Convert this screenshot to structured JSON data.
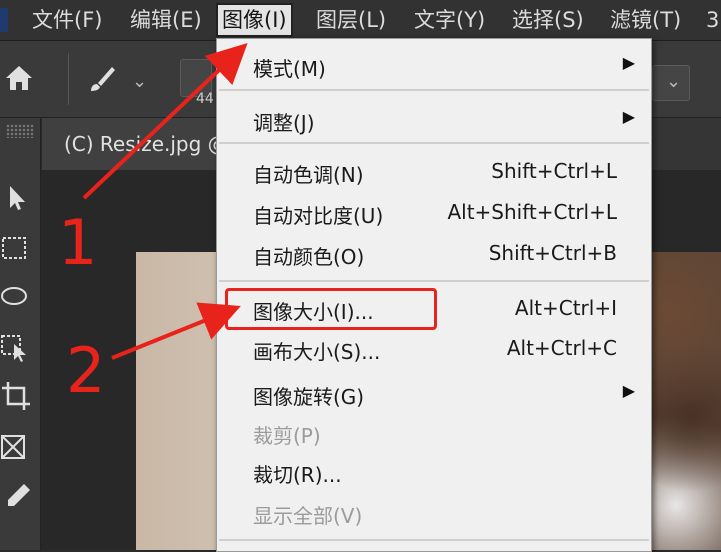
{
  "menubar": {
    "items": [
      {
        "label": "文件(F)"
      },
      {
        "label": "编辑(E)"
      },
      {
        "label": "图像(I)"
      },
      {
        "label": "图层(L)"
      },
      {
        "label": "文字(Y)"
      },
      {
        "label": "选择(S)"
      },
      {
        "label": "滤镜(T)"
      },
      {
        "label": "3"
      }
    ]
  },
  "options": {
    "brush_size_partial": "44"
  },
  "document": {
    "tab_title": "(C) Resize.jpg @"
  },
  "image_menu": {
    "items": [
      {
        "label": "模式(M)",
        "has_submenu": true
      },
      {
        "label": "调整(J)",
        "has_submenu": true
      },
      {
        "label": "自动色调(N)",
        "shortcut": "Shift+Ctrl+L"
      },
      {
        "label": "自动对比度(U)",
        "shortcut": "Alt+Shift+Ctrl+L"
      },
      {
        "label": "自动颜色(O)",
        "shortcut": "Shift+Ctrl+B"
      },
      {
        "label": "图像大小(I)...",
        "shortcut": "Alt+Ctrl+I",
        "highlighted": true
      },
      {
        "label": "画布大小(S)...",
        "shortcut": "Alt+Ctrl+C"
      },
      {
        "label": "图像旋转(G)",
        "has_submenu": true
      },
      {
        "label": "裁剪(P)",
        "disabled": true
      },
      {
        "label": "裁切(R)..."
      },
      {
        "label": "显示全部(V)",
        "disabled": true
      }
    ]
  },
  "annotations": {
    "step1": "1",
    "step2": "2",
    "color": "#e8231c"
  },
  "colors": {
    "menubar_bg": "#323232",
    "dropdown_bg": "#f0f0f0",
    "annotation_red": "#e8231c"
  }
}
